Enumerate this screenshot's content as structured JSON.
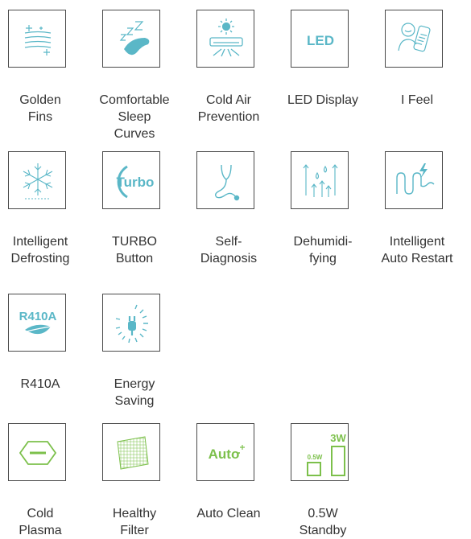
{
  "accent_color": "#5ab7c7",
  "green_color": "#7cc04b",
  "border_color": "#4a4a4a",
  "features": [
    {
      "icon": "golden-fins-icon",
      "lines": [
        "Golden",
        "Fins"
      ]
    },
    {
      "icon": "sleep-curves-icon",
      "lines": [
        "Comfortable",
        "Sleep",
        "Curves"
      ]
    },
    {
      "icon": "cold-air-prevention-icon",
      "lines": [
        "Cold Air",
        "Prevention"
      ]
    },
    {
      "icon": "led-display-icon",
      "icon_text": "LED",
      "lines": [
        "LED Display"
      ]
    },
    {
      "icon": "i-feel-icon",
      "lines": [
        "I Feel"
      ]
    },
    {
      "icon": "defrost-icon",
      "lines": [
        "Intelligent",
        "Defrosting"
      ]
    },
    {
      "icon": "turbo-icon",
      "icon_text": "Turbo",
      "lines": [
        "TURBO",
        "Button"
      ]
    },
    {
      "icon": "self-diagnosis-icon",
      "lines": [
        "Self-",
        "Diagnosis"
      ]
    },
    {
      "icon": "dehumidify-icon",
      "lines": [
        "Dehumidi-",
        "fying"
      ]
    },
    {
      "icon": "auto-restart-icon",
      "lines": [
        "Intelligent",
        "Auto Restart"
      ]
    },
    {
      "icon": "r410a-icon",
      "icon_text": "R410A",
      "lines": [
        "R410A"
      ]
    },
    {
      "icon": "energy-saving-icon",
      "lines": [
        "Energy",
        "Saving"
      ]
    },
    {
      "icon": "cold-plasma-icon",
      "lines": [
        "Cold",
        "Plasma"
      ]
    },
    {
      "icon": "healthy-filter-icon",
      "lines": [
        "Healthy",
        "Filter"
      ]
    },
    {
      "icon": "auto-clean-icon",
      "icon_text": "Auto",
      "lines": [
        "Auto Clean"
      ]
    },
    {
      "icon": "standby-icon",
      "icon_text_small": "0.5W",
      "icon_text_large": "3W",
      "lines": [
        "0.5W",
        "Standby"
      ]
    }
  ]
}
